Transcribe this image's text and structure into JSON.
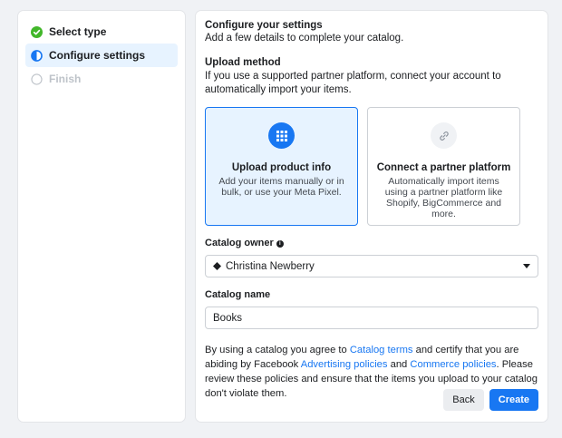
{
  "steps": [
    {
      "label": "Select type",
      "state": "done",
      "icon": "check-circle-icon"
    },
    {
      "label": "Configure settings",
      "state": "active",
      "icon": "half-circle-icon"
    },
    {
      "label": "Finish",
      "state": "disabled",
      "icon": "empty-circle-icon"
    }
  ],
  "header": {
    "title": "Configure your settings",
    "subtitle": "Add a few details to complete your catalog."
  },
  "upload": {
    "label": "Upload method",
    "description": "If you use a supported partner platform, connect your account to automatically import your items.",
    "options": [
      {
        "title": "Upload product info",
        "description": "Add your items manually or in bulk, or use your Meta Pixel.",
        "icon": "grid-icon",
        "selected": true
      },
      {
        "title": "Connect a partner platform",
        "description": "Automatically import items using a partner platform like Shopify, BigCommerce and more.",
        "icon": "link-icon",
        "selected": false
      }
    ]
  },
  "catalog_owner": {
    "label": "Catalog owner",
    "value": "Christina Newberry"
  },
  "catalog_name": {
    "label": "Catalog name",
    "value": "Books"
  },
  "legal": {
    "t1": "By using a catalog you agree to ",
    "link1": "Catalog terms",
    "t2": " and certify that you are abiding by Facebook ",
    "link2": "Advertising policies",
    "t3": " and ",
    "link3": "Commerce policies",
    "t4": ". Please review these policies and ensure that the items you upload to your catalog don't violate them."
  },
  "buttons": {
    "back": "Back",
    "create": "Create"
  },
  "colors": {
    "accent": "#1877f2",
    "success": "#42b72a",
    "selected_bg": "#e7f3ff"
  }
}
